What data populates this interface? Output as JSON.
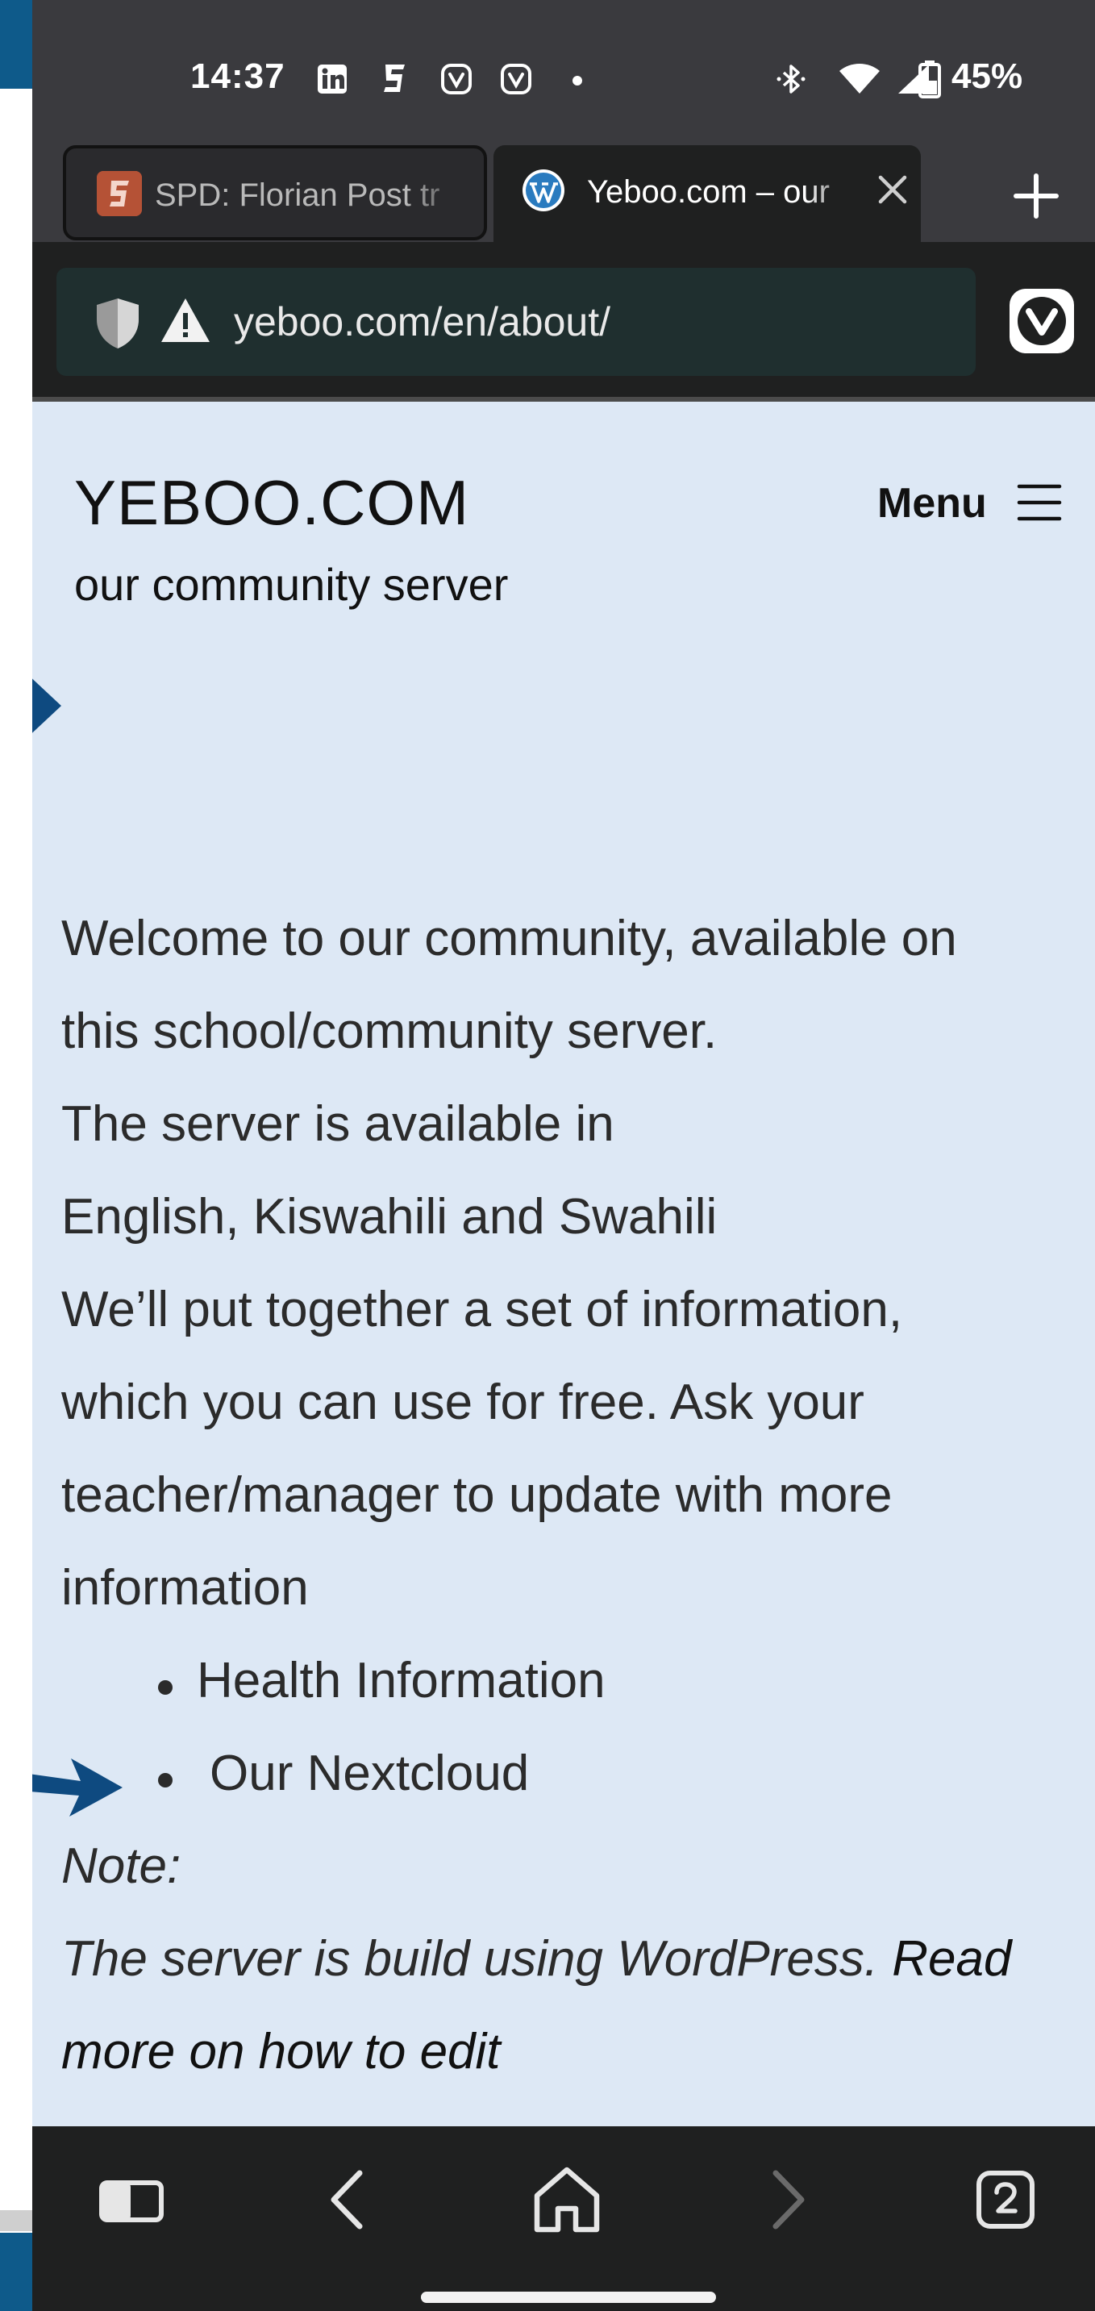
{
  "status_bar": {
    "time": "14:37",
    "battery": "45%",
    "icons": [
      "linkedin-icon",
      "s-app-icon",
      "vivaldi-icon",
      "vivaldi-icon",
      "dot-icon",
      "bluetooth-icon",
      "wifi-icon",
      "signal-icon",
      "battery-icon"
    ]
  },
  "tabs": [
    {
      "title": "SPD: Florian Post tr",
      "favicon": "s-favicon-icon",
      "active": false
    },
    {
      "title": "Yeboo.com – our",
      "favicon": "wordpress-icon",
      "active": true
    }
  ],
  "address_bar": {
    "url": "yeboo.com/en/about/"
  },
  "site": {
    "title": "YEBOO.COM",
    "tagline": "our community server",
    "menu_label": "Menu"
  },
  "content": {
    "lines": [
      "Welcome to our community, available on",
      "this school/community server.",
      "The server is available in",
      "English, Kiswahili and Swahili",
      "We’ll put together a set of information,",
      "which you can use for free. Ask your",
      "teacher/manager to update with more",
      "information"
    ],
    "list": [
      "Health Information",
      "Our Nextcloud"
    ],
    "note_label": "Note:",
    "note_text_1": "The server is build using WordPress.",
    "note_link_1": "Read",
    "note_link_2": "more on how to edit"
  },
  "colors": {
    "page_background": "#dde8f5",
    "arrow": "#0e4a80",
    "chrome_dark": "#1f2020",
    "status_bar": "#3a3a3e"
  }
}
